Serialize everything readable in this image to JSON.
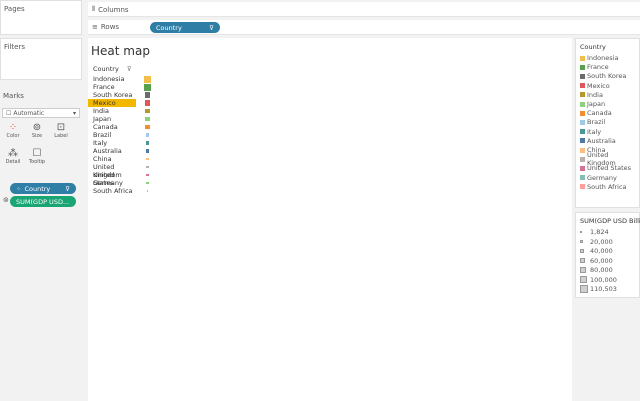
{
  "panels": {
    "pages": "Pages",
    "filters": "Filters",
    "marks": "Marks"
  },
  "shelves": {
    "columns_label": "Columns",
    "rows_label": "Rows",
    "rows_pill": "Country"
  },
  "marks": {
    "type": "Automatic",
    "buttons": {
      "color": "Color",
      "size": "Size",
      "label": "Label",
      "detail": "Detail",
      "tooltip": "Tooltip"
    },
    "fields": {
      "country": "Country",
      "gdp": "SUM(GDP USD..."
    }
  },
  "viz": {
    "title": "Heat map",
    "header": "Country",
    "rows": [
      {
        "label": "Indonesia",
        "color": "#f1c04c",
        "size": 1.0
      },
      {
        "label": "France",
        "color": "#59a14f",
        "size": 1.0
      },
      {
        "label": "South Korea",
        "color": "#6c6c6c",
        "size": 0.85
      },
      {
        "label": "Mexico",
        "color": "#e15759",
        "size": 0.85,
        "highlight": true
      },
      {
        "label": "India",
        "color": "#b6992d",
        "size": 0.7
      },
      {
        "label": "Japan",
        "color": "#8cd17d",
        "size": 0.6
      },
      {
        "label": "Canada",
        "color": "#f28e2b",
        "size": 0.6
      },
      {
        "label": "Brazil",
        "color": "#a0cbe8",
        "size": 0.55
      },
      {
        "label": "Italy",
        "color": "#499894",
        "size": 0.5
      },
      {
        "label": "Australia",
        "color": "#4e79a7",
        "size": 0.45
      },
      {
        "label": "China",
        "color": "#ffbe7d",
        "size": 0.4
      },
      {
        "label": "United Kingdom",
        "color": "#bab0ac",
        "size": 0.35
      },
      {
        "label": "United States",
        "color": "#d37295",
        "size": 0.35
      },
      {
        "label": "Germany",
        "color": "#8cd17d",
        "size": 0.3
      },
      {
        "label": "South Africa",
        "color": "#ff9d9a",
        "size": 0.25
      }
    ]
  },
  "legend": {
    "color_title": "Country",
    "color_items": [
      {
        "label": "Indonesia",
        "color": "#f1c04c"
      },
      {
        "label": "France",
        "color": "#59a14f"
      },
      {
        "label": "South Korea",
        "color": "#6c6c6c"
      },
      {
        "label": "Mexico",
        "color": "#e15759"
      },
      {
        "label": "India",
        "color": "#b6992d"
      },
      {
        "label": "Japan",
        "color": "#8cd17d"
      },
      {
        "label": "Canada",
        "color": "#f28e2b"
      },
      {
        "label": "Brazil",
        "color": "#a0cbe8"
      },
      {
        "label": "Italy",
        "color": "#499894"
      },
      {
        "label": "Australia",
        "color": "#4e79a7"
      },
      {
        "label": "China",
        "color": "#ffbe7d"
      },
      {
        "label": "United Kingdom",
        "color": "#bab0ac"
      },
      {
        "label": "United States",
        "color": "#d37295"
      },
      {
        "label": "Germany",
        "color": "#86bcb6"
      },
      {
        "label": "South Africa",
        "color": "#ff9d9a"
      }
    ],
    "size_title": "SUM(GDP USD Billions)",
    "size_items": [
      "1,824",
      "20,000",
      "40,000",
      "60,000",
      "80,000",
      "100,000",
      "110,503"
    ]
  }
}
